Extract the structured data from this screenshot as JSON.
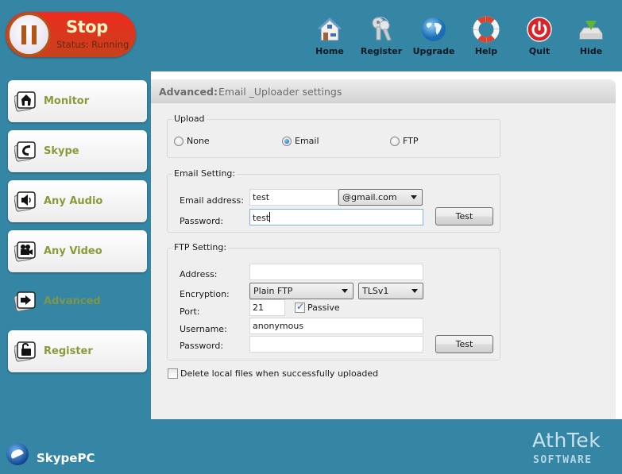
{
  "stop_button": {
    "label": "Stop",
    "status": "Status: Running"
  },
  "toolbar": {
    "items": [
      {
        "label": "Home",
        "icon": "home-icon"
      },
      {
        "label": "Register",
        "icon": "keys-icon"
      },
      {
        "label": "Upgrade",
        "icon": "globe-icon"
      },
      {
        "label": "Help",
        "icon": "lifebuoy-icon"
      },
      {
        "label": "Quit",
        "icon": "power-icon"
      },
      {
        "label": "Hide",
        "icon": "hide-tray-icon"
      }
    ]
  },
  "sidebar": {
    "items": [
      {
        "label": "Monitor",
        "icon": "monitor-home-icon",
        "active": false
      },
      {
        "label": "Skype",
        "icon": "phone-icon",
        "active": false
      },
      {
        "label": "Any Audio",
        "icon": "speaker-icon",
        "active": false
      },
      {
        "label": "Any Video",
        "icon": "video-camera-icon",
        "active": false
      },
      {
        "label": "Advanced",
        "icon": "arrow-right-icon",
        "active": true
      },
      {
        "label": "Register",
        "icon": "padlock-icon",
        "active": false
      }
    ]
  },
  "panel": {
    "header_bold": "Advanced:",
    "header_rest": "Email _Uploader settings",
    "upload": {
      "title": "Upload",
      "options": [
        {
          "label": "None",
          "selected": false
        },
        {
          "label": "Email",
          "selected": true
        },
        {
          "label": "FTP",
          "selected": false
        }
      ]
    },
    "email": {
      "title": "Email Setting:",
      "address_label": "Email address:",
      "address_value": "test",
      "domain_selected": "@gmail.com",
      "password_label": "Password:",
      "password_value": "test",
      "test_button": "Test"
    },
    "ftp": {
      "title": "FTP Setting:",
      "address_label": "Address:",
      "address_value": "",
      "encryption_label": "Encryption:",
      "encryption_selected": "Plain FTP",
      "tls_selected": "TLSv1",
      "port_label": "Port:",
      "port_value": "21",
      "passive_label": "Passive",
      "passive_checked": true,
      "username_label": "Username:",
      "username_value": "anonymous",
      "password_label": "Password:",
      "password_value": "",
      "test_button": "Test"
    },
    "delete_local": {
      "label": "Delete local files when successfully uploaded",
      "checked": false
    }
  },
  "footer": {
    "brand": "SkypePC",
    "vendor": "AthTek",
    "vendor_sub": "SOFTWARE"
  },
  "colors": {
    "background": "#3585a4",
    "stop_red": "#e3301e",
    "nav_label": "#8a9a3a",
    "panel_bg": "#efefef"
  }
}
